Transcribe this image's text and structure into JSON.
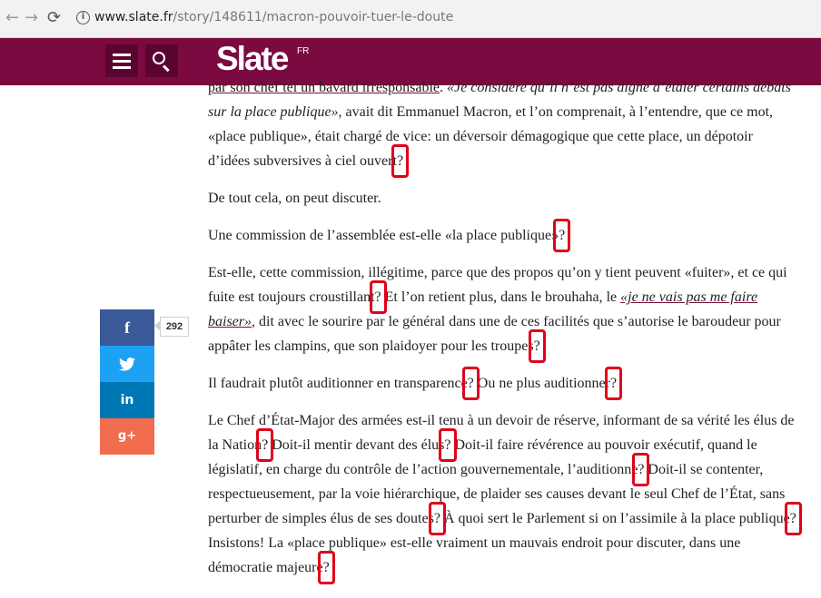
{
  "browser": {
    "back_icon": "←",
    "forward_icon": "→",
    "reload_icon": "⟳",
    "info_icon": "i",
    "url_host": "www.slate.fr",
    "url_path": "/story/148611/macron-pouvoir-tuer-le-doute"
  },
  "header": {
    "logo": "Slate",
    "logo_suffix": "FR",
    "brand_color": "#7a0a3f"
  },
  "share": {
    "facebook": "f",
    "twitter_icon": "twitter-bird",
    "linkedin": "in",
    "googleplus": "g+",
    "count": "292"
  },
  "article": {
    "p1": {
      "a": "par son chef tel un bavard irresponsable",
      "b": ". ",
      "c": "«Je considère qu’il n’est pas digne d’étaler certains débats sur la place publique»",
      "d": ", avait dit Emmanuel Macron, et l’on comprenait, à l’entendre, que ce mot, «place publique», était chargé de vice: un déversoir démagogique que cette place, un dépotoir d’idées subversives à ciel ouvert"
    },
    "p2": "De tout cela, on peut discuter.",
    "p3": "Une commission de l’assemblée est-elle «la place publique»",
    "p4": {
      "a": "Est-elle, cette commission, illégitime, parce que des propos qu’on y tient peuvent «fuiter», et ce qui fuite est toujours croustillant",
      "b": " Et l’on retient plus, dans le brouhaha, le ",
      "c": "«je ne vais pas me faire baiser»",
      "d": ", dit avec le sourire par le général dans une de ces facilités que s’autorise le baroudeur pour appâter les clampins, que son plaidoyer pour les troupes"
    },
    "p5": {
      "a": "Il faudrait plutôt auditionner en transparence",
      "b": " Ou ne plus auditionner"
    },
    "p6": {
      "a": "Le Chef d’État-Major des armées est-il tenu à un devoir de réserve, informant de sa vérité les élus de la Nation",
      "b": " Doit-il mentir devant des élus",
      "c": " Doit-il faire révérence au pouvoir exécutif, quand le législatif, en charge du contrôle de l’action gouvernementale, l’auditionne",
      "d": " Doit-il se contenter, respectueusement, par la voie hiérarchique, de plaider ses causes devant le seul Chef de l’État, sans perturber de simples élus de ses doutes",
      "e": " À quoi sert le Parlement si on l’assimile à la place publique",
      "f": " Insistons! La «place publique» est-elle vraiment un mauvais endroit pour discuter, dans une démocratie majeure"
    },
    "qmark": "?"
  },
  "colors": {
    "highlight": "#e0001b",
    "facebook": "#3b5998",
    "twitter": "#1da1f2",
    "linkedin": "#0077b5",
    "googleplus": "#f26c4f"
  }
}
